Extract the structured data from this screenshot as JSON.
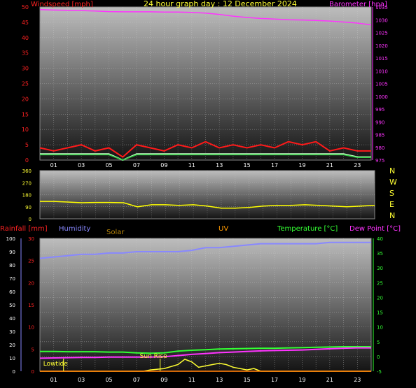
{
  "title": "24 hour graph day : 12 December 2024",
  "colors": {
    "wind_avg": "#2ecc40",
    "wind_gust": "#ff1a1a",
    "wind_light": "#c8ffc8",
    "barometer": "#ff33ff",
    "direction": "#ffff00",
    "humidity": "#8888ff",
    "temperature": "#33ff33",
    "dewpoint": "#ff33ff",
    "rain": "#ff2222",
    "solar": "#ffff33",
    "uv": "#ff9900"
  },
  "chart_data": [
    {
      "type": "line",
      "title": "24 hour graph day : 12 December 2024",
      "ylabel": "Windspeed [mph]",
      "y2label": "Barometer [hpa]",
      "ylim": [
        0,
        50
      ],
      "y2lim": [
        975,
        1035
      ],
      "yticks": [
        "0",
        "5",
        "10",
        "15",
        "20",
        "25",
        "30",
        "35",
        "40",
        "45",
        "50"
      ],
      "y2ticks": [
        "975",
        "980",
        "985",
        "990",
        "995",
        "1000",
        "1005",
        "1010",
        "1015",
        "1020",
        "1025",
        "1030",
        "1035"
      ],
      "xticks": [
        "01",
        "03",
        "05",
        "07",
        "09",
        "11",
        "13",
        "15",
        "17",
        "19",
        "21",
        "23"
      ],
      "grid": true,
      "series": [
        {
          "name": "Barometer [hpa]",
          "axis": "right",
          "x": [
            0,
            1,
            2,
            3,
            4,
            5,
            6,
            7,
            8,
            9,
            10,
            11,
            12,
            13,
            14,
            15,
            16,
            17,
            18,
            19,
            20,
            21,
            22,
            23,
            24
          ],
          "values": [
            1034.0,
            1033.8,
            1033.7,
            1033.6,
            1033.4,
            1033.2,
            1033.1,
            1033.1,
            1033.1,
            1033.0,
            1033.0,
            1032.9,
            1032.6,
            1032.1,
            1031.4,
            1030.9,
            1030.5,
            1030.3,
            1030.0,
            1029.9,
            1029.7,
            1029.5,
            1029.1,
            1028.7,
            1028.0
          ]
        },
        {
          "name": "Windspeed gust [mph]",
          "axis": "left",
          "x": [
            0,
            1,
            2,
            3,
            4,
            5,
            6,
            7,
            8,
            9,
            10,
            11,
            12,
            13,
            14,
            15,
            16,
            17,
            18,
            19,
            20,
            21,
            22,
            23,
            24
          ],
          "values": [
            4,
            3,
            4,
            5,
            3,
            4,
            1,
            5,
            4,
            3,
            5,
            4,
            6,
            4,
            5,
            4,
            5,
            4,
            6,
            5,
            6,
            3,
            4,
            3,
            3
          ]
        },
        {
          "name": "Windspeed avg [mph]",
          "axis": "left",
          "x": [
            0,
            1,
            2,
            3,
            4,
            5,
            6,
            7,
            8,
            9,
            10,
            11,
            12,
            13,
            14,
            15,
            16,
            17,
            18,
            19,
            20,
            21,
            22,
            23,
            24
          ],
          "values": [
            2,
            2,
            2,
            2,
            2,
            2,
            0,
            2,
            2,
            2,
            2,
            2,
            2,
            2,
            2,
            2,
            2,
            2,
            2,
            2,
            2,
            2,
            2,
            1,
            1
          ]
        }
      ]
    },
    {
      "type": "line",
      "ylabel": "Wind direction",
      "ylim": [
        0,
        360
      ],
      "yticks": [
        "0",
        "90",
        "180",
        "270",
        "360"
      ],
      "compass": [
        "N",
        "W",
        "S",
        "E",
        "N"
      ],
      "xticks": [
        "01",
        "03",
        "05",
        "07",
        "09",
        "11",
        "13",
        "15",
        "17",
        "19",
        "21",
        "23"
      ],
      "grid": true,
      "series": [
        {
          "name": "Wind direction",
          "x": [
            0,
            1,
            2,
            3,
            4,
            5,
            6,
            7,
            8,
            9,
            10,
            11,
            12,
            13,
            14,
            15,
            16,
            17,
            18,
            19,
            20,
            21,
            22,
            23,
            24
          ],
          "values": [
            130,
            130,
            125,
            120,
            122,
            122,
            120,
            90,
            105,
            105,
            100,
            105,
            95,
            80,
            80,
            85,
            95,
            100,
            100,
            105,
            100,
            95,
            90,
            95,
            100
          ]
        }
      ]
    },
    {
      "type": "line",
      "legend": [
        "Rainfall [mm]",
        "Humidity",
        "Solar",
        "UV",
        "Temperature [°C]",
        "Dew Point [°C]"
      ],
      "rain_axis": {
        "label": "Rainfall [mm]",
        "ylim": [
          0,
          30
        ],
        "yticks": [
          "0",
          "5",
          "10",
          "15",
          "20",
          "25",
          "30"
        ]
      },
      "humidity_axis": {
        "label": "Humidity",
        "ylim": [
          0,
          100
        ],
        "yticks": [
          "0",
          "10",
          "20",
          "30",
          "40",
          "50",
          "60",
          "70",
          "80",
          "90",
          "100"
        ]
      },
      "temp_axis": {
        "label": "Temperature [°C]",
        "ylim": [
          -5,
          40
        ],
        "yticks": [
          "-5",
          "0",
          "5",
          "10",
          "15",
          "20",
          "25",
          "30",
          "35",
          "40"
        ]
      },
      "xticks": [
        "01",
        "03",
        "05",
        "07",
        "09",
        "11",
        "13",
        "15",
        "17",
        "19",
        "21",
        "23"
      ],
      "grid": true,
      "annotations": [
        {
          "text": "Lowtide",
          "x": 1.0
        },
        {
          "text": "Sun Rise",
          "x": 8.0
        }
      ],
      "series": [
        {
          "name": "Humidity",
          "axis": "humidity",
          "x": [
            0,
            1,
            2,
            3,
            4,
            5,
            6,
            7,
            8,
            9,
            10,
            11,
            12,
            13,
            14,
            15,
            16,
            17,
            18,
            19,
            20,
            21,
            22,
            23,
            24
          ],
          "values": [
            85,
            86,
            87,
            88,
            88,
            89,
            89,
            90,
            90,
            90,
            90,
            91,
            93,
            93,
            94,
            95,
            96,
            96,
            96,
            96,
            96,
            97,
            97,
            97,
            97
          ]
        },
        {
          "name": "Temperature [°C]",
          "axis": "temp",
          "x": [
            0,
            1,
            2,
            3,
            4,
            5,
            6,
            7,
            8,
            9,
            10,
            11,
            12,
            13,
            14,
            15,
            16,
            17,
            18,
            19,
            20,
            21,
            22,
            23,
            24
          ],
          "values": [
            1.7,
            1.7,
            1.6,
            1.6,
            1.6,
            1.5,
            1.5,
            1.2,
            1.1,
            1.2,
            1.8,
            2.1,
            2.3,
            2.5,
            2.6,
            2.7,
            2.8,
            2.8,
            2.9,
            3.0,
            3.1,
            3.2,
            3.3,
            3.3,
            3.3
          ]
        },
        {
          "name": "Dew Point [°C]",
          "axis": "temp",
          "x": [
            0,
            1,
            2,
            3,
            4,
            5,
            6,
            7,
            8,
            9,
            10,
            11,
            12,
            13,
            14,
            15,
            16,
            17,
            18,
            19,
            20,
            21,
            22,
            23,
            24
          ],
          "values": [
            -0.6,
            -0.5,
            -0.4,
            -0.3,
            -0.3,
            -0.2,
            -0.2,
            -0.2,
            -0.2,
            -0.1,
            0.3,
            0.7,
            1.0,
            1.3,
            1.5,
            1.7,
            1.9,
            2.0,
            2.1,
            2.2,
            2.4,
            2.6,
            2.8,
            2.9,
            2.9
          ]
        },
        {
          "name": "Solar",
          "axis": "humidity",
          "x": [
            0,
            1,
            2,
            3,
            4,
            5,
            6,
            7,
            7.5,
            8,
            9,
            10,
            10.5,
            11,
            11.5,
            12,
            13,
            13.5,
            14,
            15,
            15.5,
            16,
            24
          ],
          "values": [
            0,
            0,
            0,
            0,
            0,
            0,
            0,
            0,
            0,
            1,
            2,
            5,
            9,
            7,
            3,
            4,
            6,
            5,
            3,
            1,
            2,
            0,
            0
          ]
        },
        {
          "name": "Rainfall [mm]",
          "axis": "rain",
          "x": [
            0,
            24
          ],
          "values": [
            0,
            0
          ]
        },
        {
          "name": "UV",
          "axis": "rain",
          "x": [
            0,
            24
          ],
          "values": [
            0,
            0
          ]
        }
      ]
    }
  ]
}
